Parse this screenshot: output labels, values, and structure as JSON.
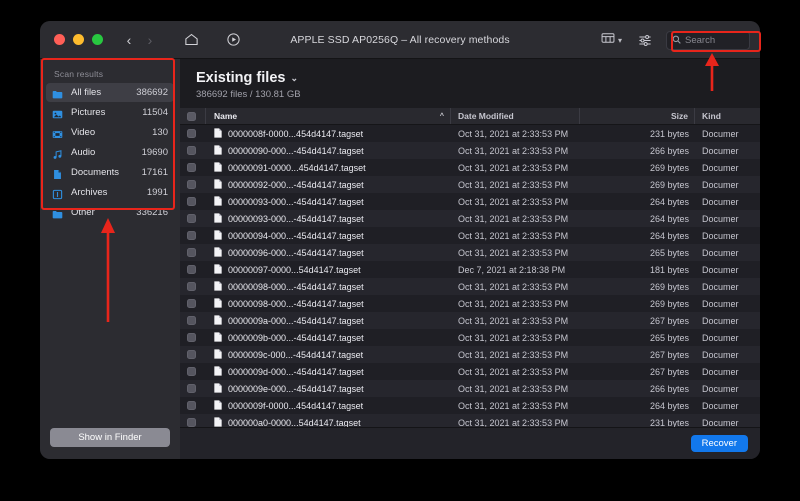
{
  "window": {
    "title": "APPLE SSD AP0256Q – All recovery methods",
    "traffic": {
      "close": "close-button",
      "minimize": "minimize-button",
      "zoom": "zoom-button"
    },
    "nav": {
      "back": "‹",
      "forward": "›"
    }
  },
  "toolbar": {
    "home_icon": "home-icon",
    "scan_icon": "scan-play-icon",
    "viewmode_icon": "view-columns-icon",
    "viewmode_chevron": "▾",
    "filter_icon": "filter-sliders-icon",
    "search_icon": "search-icon",
    "search_placeholder": "Search",
    "search_value": ""
  },
  "sidebar": {
    "header": "Scan results",
    "items": [
      {
        "label": "All files",
        "count": "386692",
        "icon": "folder-icon",
        "color": "#2f8fe0",
        "active": true
      },
      {
        "label": "Pictures",
        "count": "11504",
        "icon": "picture-icon",
        "color": "#2f8fe0",
        "active": false
      },
      {
        "label": "Video",
        "count": "130",
        "icon": "video-icon",
        "color": "#2f8fe0",
        "active": false
      },
      {
        "label": "Audio",
        "count": "19690",
        "icon": "audio-icon",
        "color": "#2f8fe0",
        "active": false
      },
      {
        "label": "Documents",
        "count": "17161",
        "icon": "document-icon",
        "color": "#2f8fe0",
        "active": false
      },
      {
        "label": "Archives",
        "count": "1991",
        "icon": "archive-icon",
        "color": "#2f8fe0",
        "active": false
      },
      {
        "label": "Other",
        "count": "336216",
        "icon": "other-icon",
        "color": "#2f8fe0",
        "active": false
      }
    ],
    "show_in_finder": "Show in Finder"
  },
  "main": {
    "title": "Existing files",
    "title_chevron": "⌄",
    "subtitle": "386692 files / 130.81 GB",
    "columns": {
      "name": "Name",
      "date_modified": "Date Modified",
      "size": "Size",
      "kind": "Kind",
      "sort_indicator": "^"
    },
    "rows": [
      {
        "name": "0000008f-0000...454d4147.tagset",
        "date": "Oct 31, 2021 at 2:33:53 PM",
        "size": "231 bytes",
        "kind": "Documer"
      },
      {
        "name": "00000090-000...-454d4147.tagset",
        "date": "Oct 31, 2021 at 2:33:53 PM",
        "size": "266 bytes",
        "kind": "Documer"
      },
      {
        "name": "00000091-0000...454d4147.tagset",
        "date": "Oct 31, 2021 at 2:33:53 PM",
        "size": "269 bytes",
        "kind": "Documer"
      },
      {
        "name": "00000092-000...-454d4147.tagset",
        "date": "Oct 31, 2021 at 2:33:53 PM",
        "size": "269 bytes",
        "kind": "Documer"
      },
      {
        "name": "00000093-000...-454d4147.tagset",
        "date": "Oct 31, 2021 at 2:33:53 PM",
        "size": "264 bytes",
        "kind": "Documer"
      },
      {
        "name": "00000093-000...-454d4147.tagset",
        "date": "Oct 31, 2021 at 2:33:53 PM",
        "size": "264 bytes",
        "kind": "Documer"
      },
      {
        "name": "00000094-000...-454d4147.tagset",
        "date": "Oct 31, 2021 at 2:33:53 PM",
        "size": "264 bytes",
        "kind": "Documer"
      },
      {
        "name": "00000096-000...-454d4147.tagset",
        "date": "Oct 31, 2021 at 2:33:53 PM",
        "size": "265 bytes",
        "kind": "Documer"
      },
      {
        "name": "00000097-0000...54d4147.tagset",
        "date": "Dec 7, 2021 at 2:18:38 PM",
        "size": "181 bytes",
        "kind": "Documer"
      },
      {
        "name": "00000098-000...-454d4147.tagset",
        "date": "Oct 31, 2021 at 2:33:53 PM",
        "size": "269 bytes",
        "kind": "Documer"
      },
      {
        "name": "00000098-000...-454d4147.tagset",
        "date": "Oct 31, 2021 at 2:33:53 PM",
        "size": "269 bytes",
        "kind": "Documer"
      },
      {
        "name": "0000009a-000...-454d4147.tagset",
        "date": "Oct 31, 2021 at 2:33:53 PM",
        "size": "267 bytes",
        "kind": "Documer"
      },
      {
        "name": "0000009b-000...-454d4147.tagset",
        "date": "Oct 31, 2021 at 2:33:53 PM",
        "size": "265 bytes",
        "kind": "Documer"
      },
      {
        "name": "0000009c-000...-454d4147.tagset",
        "date": "Oct 31, 2021 at 2:33:53 PM",
        "size": "267 bytes",
        "kind": "Documer"
      },
      {
        "name": "0000009d-000...-454d4147.tagset",
        "date": "Oct 31, 2021 at 2:33:53 PM",
        "size": "267 bytes",
        "kind": "Documer"
      },
      {
        "name": "0000009e-000...-454d4147.tagset",
        "date": "Oct 31, 2021 at 2:33:53 PM",
        "size": "266 bytes",
        "kind": "Documer"
      },
      {
        "name": "0000009f-0000...454d4147.tagset",
        "date": "Oct 31, 2021 at 2:33:53 PM",
        "size": "264 bytes",
        "kind": "Documer"
      },
      {
        "name": "000000a0-0000...54d4147.tagset",
        "date": "Oct 31, 2021 at 2:33:53 PM",
        "size": "231 bytes",
        "kind": "Documer"
      }
    ]
  },
  "footer": {
    "recover": "Recover"
  },
  "annotations": {
    "color": "#e8251b"
  }
}
